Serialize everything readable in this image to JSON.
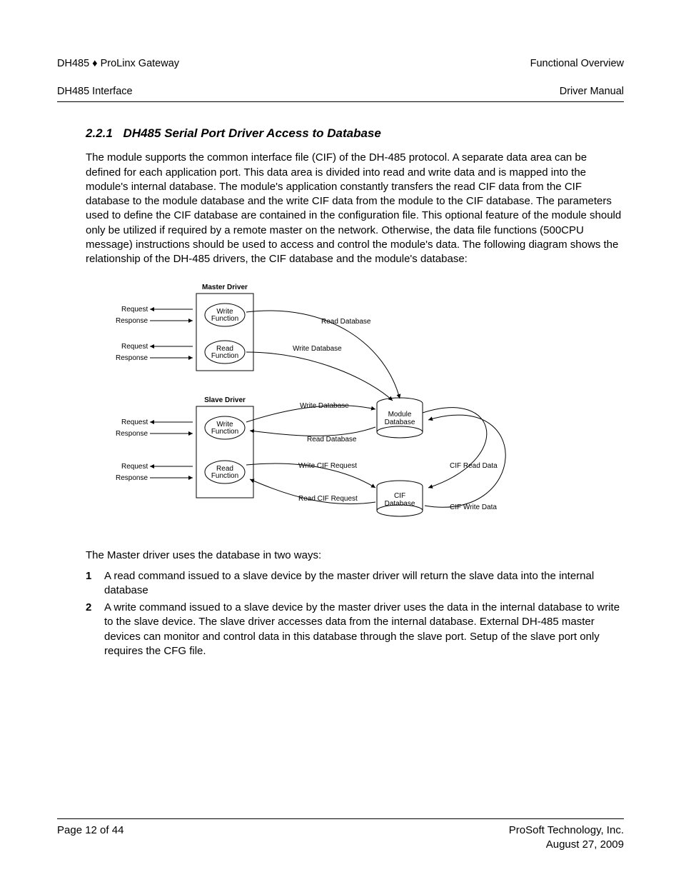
{
  "header": {
    "left_line1": "DH485 ♦ ProLinx Gateway",
    "left_line2": "DH485 Interface",
    "right_line1": "Functional Overview",
    "right_line2": "Driver Manual"
  },
  "section": {
    "number": "2.2.1",
    "title": "DH485 Serial Port Driver Access to Database"
  },
  "paragraph1": "The module supports the common interface file (CIF) of the DH-485 protocol. A separate data area can be defined for each application port. This data area is divided into read and write data and is mapped into the module's internal database. The module's application constantly transfers the read CIF data from the CIF database to the module database and the write CIF data from the module to the CIF database. The parameters used to define the CIF database are contained in the configuration file. This optional feature of the module should only be utilized if required by a remote master on the network. Otherwise, the data file functions (500CPU message) instructions should be used to access and control the module's data. The following diagram shows the relationship of the DH-485 drivers, the CIF database and the module's database:",
  "diagram": {
    "master_driver": "Master Driver",
    "slave_driver": "Slave Driver",
    "write_function": "Write Function",
    "read_function": "Read Function",
    "request": "Request",
    "response": "Response",
    "read_database": "Read Database",
    "write_database": "Write Database",
    "module_database": "Module Database",
    "cif_database": "CIF Database",
    "write_cif_request": "Write CIF Request",
    "read_cif_request": "Read CIF Request",
    "cif_read_data": "CIF Read Data",
    "cif_write_data": "CIF Write Data"
  },
  "intro_line": "The Master driver uses the database in two ways:",
  "list": [
    {
      "num": "1",
      "text": "A read command issued to a slave device by the master driver will return the slave data into the internal database"
    },
    {
      "num": "2",
      "text": "A write command issued to a slave device by the master driver uses the data in the internal database to write to the slave device. The slave driver accesses data from the internal database. External DH-485 master devices can monitor and control data in this database through the slave port. Setup of the slave port only requires the CFG file."
    }
  ],
  "footer": {
    "left": "Page 12 of 44",
    "right_line1": "ProSoft Technology, Inc.",
    "right_line2": "August 27, 2009"
  }
}
